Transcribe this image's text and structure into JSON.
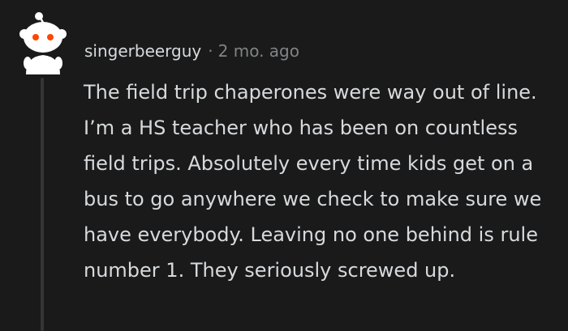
{
  "comment": {
    "author": "singerbeerguy",
    "separator": "·",
    "time_ago": "2 mo. ago",
    "body": "The field trip chaperones were way out of line. I’m a HS teacher who has been on countless field trips. Absolutely every time kids get on a bus to go anywhere we check to make sure we have everybody. Leaving no one behind is rule number 1. They seriously screwed up."
  },
  "icons": {
    "avatar": "reddit-snoo-avatar-icon"
  },
  "colors": {
    "background": "#1a1a1b",
    "text_primary": "#d7dadc",
    "text_muted": "#818384",
    "thread_line": "#343536",
    "snoo_eye": "#ff4500"
  }
}
